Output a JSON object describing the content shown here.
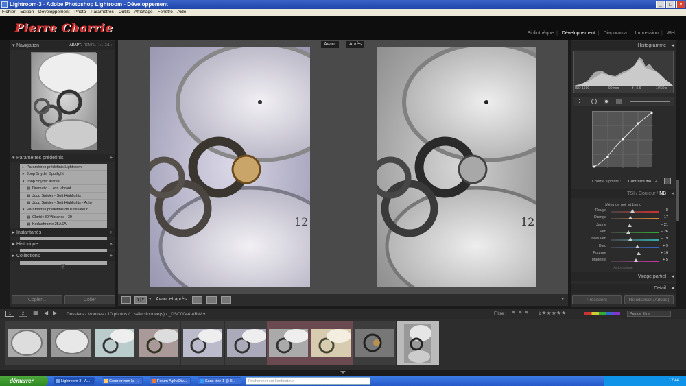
{
  "window": {
    "title": "Lightroom-3 - Adobe Photoshop Lightroom - Développement",
    "controls": [
      "_",
      "□",
      "×"
    ]
  },
  "menu": [
    "Fichier",
    "Edition",
    "Développement",
    "Photo",
    "Paramètres",
    "Outils",
    "Affichage",
    "Fenêtre",
    "Aide"
  ],
  "identity_plate": "Pierre Charrie",
  "modules": [
    "Bibliothèque",
    "Développement",
    "Diaporama",
    "Impression",
    "Web"
  ],
  "active_module": "Développement",
  "left": {
    "navigation": {
      "title": "Navigation",
      "options": [
        "ADAPT.",
        "REMPL.",
        "1:1",
        "2:1 ÷"
      ],
      "selected": "ADAPT."
    },
    "presets": {
      "title": "Paramètres prédéfinis",
      "items": [
        {
          "mark": "▸",
          "label": "Paramètres prédéfinis Lightroom"
        },
        {
          "mark": "▸",
          "label": "Joop Snyder Spotlight"
        },
        {
          "mark": "▾",
          "label": "Joop Snyder autres"
        },
        {
          "mark": "▤",
          "label": "Dramatic - Less vibrant"
        },
        {
          "mark": "▤",
          "label": "Joop Snijder - Soft Highlights"
        },
        {
          "mark": "▤",
          "label": "Joop Snijder - Soft Highlights - Auto"
        },
        {
          "mark": "▾",
          "label": "Paramètres prédéfinis de l'utilisateur"
        },
        {
          "mark": "▤",
          "label": "Clarté+39 Vibrance +39"
        },
        {
          "mark": "▤",
          "label": "Kodachrome 25ASA"
        }
      ]
    },
    "sections": [
      {
        "title": "Instantanés",
        "action": "+"
      },
      {
        "title": "Historique",
        "action": "×"
      },
      {
        "title": "Collections",
        "action": "+"
      }
    ],
    "copy_button": "Copier...",
    "paste_button": "Coller"
  },
  "center": {
    "before_label": "Avant",
    "after_label": "Après",
    "toolbar_label": "Avant et après :"
  },
  "right": {
    "histogram_title": "Histogramme",
    "exif": [
      "ISO 1600",
      "90 mm",
      "f / 5,6",
      "1/400 s"
    ],
    "tone_curve_label": "Courbe à points :",
    "tone_curve_value": "Contraste mo... ÷",
    "hsl_tabs": [
      "TSI",
      "Couleur",
      "NB"
    ],
    "bw_mix_title": "Mélange noir et blanc",
    "bw_mix": [
      {
        "name": "Rouge",
        "value": "– 8",
        "color": "#c33",
        "pos": 0.46
      },
      {
        "name": "Orange",
        "value": "– 17",
        "color": "#d83",
        "pos": 0.42
      },
      {
        "name": "Jaune",
        "value": "– 21",
        "color": "#cc3",
        "pos": 0.4
      },
      {
        "name": "Vert",
        "value": "– 26",
        "color": "#3a3",
        "pos": 0.37
      },
      {
        "name": "Bleu vert",
        "value": "– 19",
        "color": "#3aa",
        "pos": 0.41
      },
      {
        "name": "Bleu",
        "value": "+ 9",
        "color": "#36c",
        "pos": 0.55
      },
      {
        "name": "Pourpre",
        "value": "+ 16",
        "color": "#83c",
        "pos": 0.58
      },
      {
        "name": "Magenta",
        "value": "+ 5",
        "color": "#c3a",
        "pos": 0.53
      }
    ],
    "auto_label": "Automatique",
    "split_toning": "Virage partiel",
    "detail": "Détail",
    "previous_button": "Précédent",
    "reset_button": "Réinitialiser (Adobe)"
  },
  "filmbar": {
    "pages": [
      "1",
      "2"
    ],
    "path": "Dossiers / Montres / 10 photos / 1 sélectionnée(s) / _DSC0044.ARW ▾",
    "filter_label": "Filtre :",
    "filter_value": "Pas de filtre"
  },
  "taskbar": {
    "start": "démarrer",
    "tasks": [
      "Lightroom-3 - A...",
      "Courrier non lu -...",
      "Forum AlphaDiv...",
      "Sans titre-1 @ 6..."
    ],
    "search_placeholder": "Rechercher sur l'ordinateur",
    "clock": "12:44"
  }
}
